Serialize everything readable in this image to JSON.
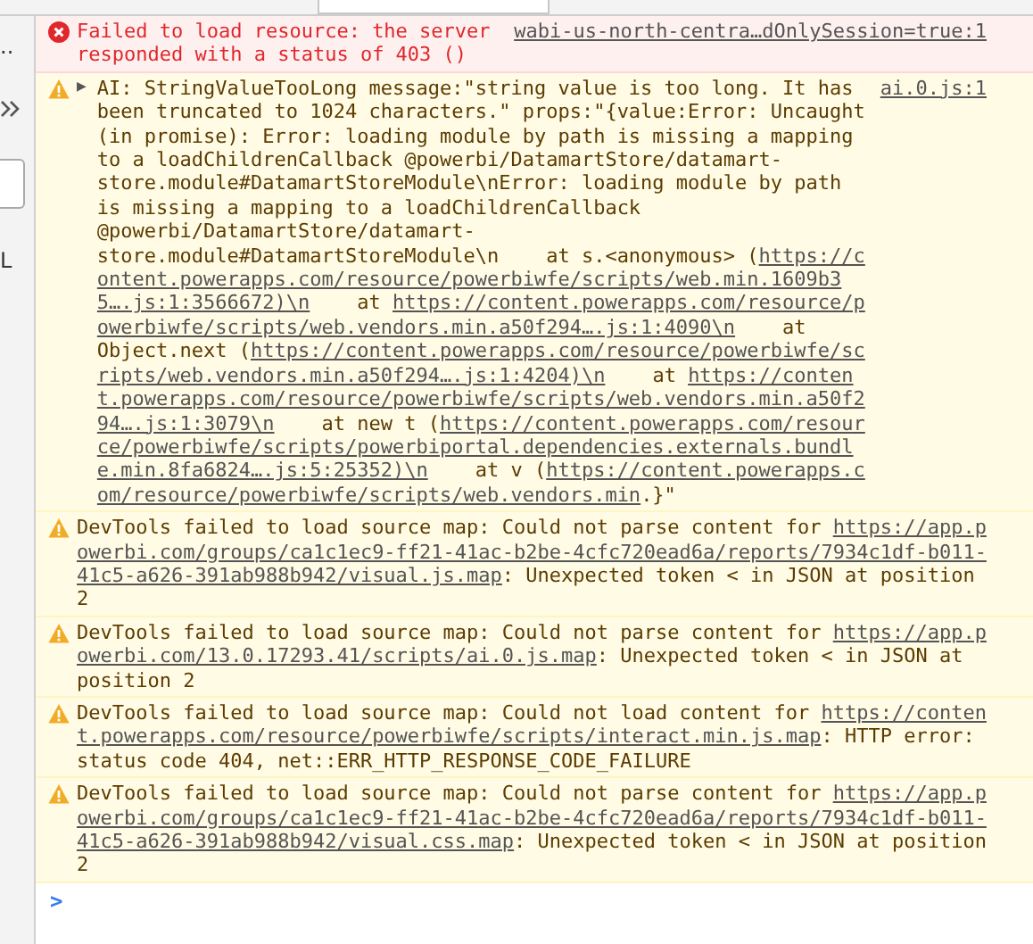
{
  "sidebar": {
    "items": [
      {
        "kind": "text",
        "text": ".."
      },
      {
        "kind": "icon"
      },
      {
        "kind": "field"
      },
      {
        "kind": "text",
        "text": "L"
      }
    ]
  },
  "console": {
    "messages": [
      {
        "kind": "error",
        "parts": [
          {
            "kind": "text",
            "text": "Failed to load resource: the server responded with a status of 403 ()"
          }
        ],
        "source": "wabi-us-north-centra…dOnlySession=true:1"
      },
      {
        "kind": "warning",
        "toggle": "▶",
        "parts": [
          {
            "kind": "text",
            "text": "AI: StringValueTooLong message:\"string value is too long. It has been truncated to 1024 characters.\" props:\"{value:Error: Uncaught (in promise): Error: loading module by path is missing a mapping to a loadChildrenCallback @powerbi/DatamartStore/datamart-store.module#DatamartStoreModule\\nError: loading module by path is missing a mapping to a loadChildrenCallback @powerbi/DatamartStore/datamart-store.module#DatamartStoreModule\\n    at s.<anonymous> ("
          },
          {
            "kind": "link",
            "text": "https://content.powerapps.com/resource/powerbiwfe/scripts/web.min.1609b35….js:1:3566672)\\n"
          },
          {
            "kind": "text",
            "text": "    at "
          },
          {
            "kind": "link",
            "text": "https://content.powerapps.com/resource/powerbiwfe/scripts/web.vendors.min.a50f294….js:1:4090\\n"
          },
          {
            "kind": "text",
            "text": "    at Object.next ("
          },
          {
            "kind": "link",
            "text": "https://content.powerapps.com/resource/powerbiwfe/scripts/web.vendors.min.a50f294….js:1:4204)\\n"
          },
          {
            "kind": "text",
            "text": "    at "
          },
          {
            "kind": "link",
            "text": "https://content.powerapps.com/resource/powerbiwfe/scripts/web.vendors.min.a50f294….js:1:3079\\n"
          },
          {
            "kind": "text",
            "text": "    at new t ("
          },
          {
            "kind": "link",
            "text": "https://content.powerapps.com/resource/powerbiwfe/scripts/powerbiportal.dependencies.externals.bundle.min.8fa6824….js:5:25352)\\n"
          },
          {
            "kind": "text",
            "text": "    at v ("
          },
          {
            "kind": "link",
            "text": "https://content.powerapps.com/resource/powerbiwfe/scripts/web.vendors.min"
          },
          {
            "kind": "text",
            "text": ".}\""
          }
        ],
        "source": "ai.0.js:1"
      },
      {
        "kind": "warning",
        "parts": [
          {
            "kind": "text",
            "text": "DevTools failed to load source map: Could not parse content for "
          },
          {
            "kind": "link",
            "text": "https://app.powerbi.com/groups/ca1c1ec9-ff21-41ac-b2be-4cfc720ead6a/reports/7934c1df-b011-41c5-a626-391ab988b942/visual.js.map"
          },
          {
            "kind": "text",
            "text": ": Unexpected token < in JSON at position 2"
          }
        ]
      },
      {
        "kind": "warning",
        "parts": [
          {
            "kind": "text",
            "text": "DevTools failed to load source map: Could not parse content for "
          },
          {
            "kind": "link",
            "text": "https://app.powerbi.com/13.0.17293.41/scripts/ai.0.js.map"
          },
          {
            "kind": "text",
            "text": ": Unexpected token < in JSON at position 2"
          }
        ]
      },
      {
        "kind": "warning",
        "parts": [
          {
            "kind": "text",
            "text": "DevTools failed to load source map: Could not load content for "
          },
          {
            "kind": "link",
            "text": "https://content.powerapps.com/resource/powerbiwfe/scripts/interact.min.js.map"
          },
          {
            "kind": "text",
            "text": ": HTTP error: status code 404, net::ERR_HTTP_RESPONSE_CODE_FAILURE"
          }
        ]
      },
      {
        "kind": "warning",
        "parts": [
          {
            "kind": "text",
            "text": "DevTools failed to load source map: Could not parse content for "
          },
          {
            "kind": "link",
            "text": "https://app.powerbi.com/groups/ca1c1ec9-ff21-41ac-b2be-4cfc720ead6a/reports/7934c1df-b011-41c5-a626-391ab988b942/visual.css.map"
          },
          {
            "kind": "text",
            "text": ": Unexpected token < in JSON at position 2"
          }
        ]
      }
    ],
    "prompt": ">"
  }
}
